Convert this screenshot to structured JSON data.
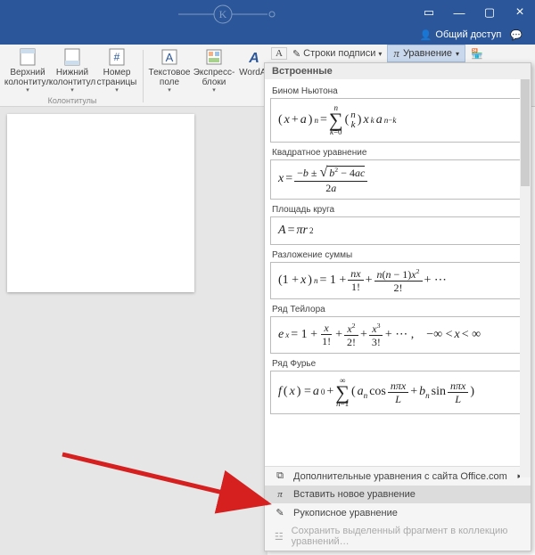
{
  "titlebar": {
    "min": "—",
    "max": "▢",
    "close": "×"
  },
  "secondbar": {
    "share": "Общий доступ"
  },
  "ribbon": {
    "group1_label": "Колонтитулы",
    "item_top": "Верхний колонтитул",
    "item_bottom": "Нижний колонтитул",
    "item_page": "Номер страницы",
    "item_text": "Текстовое поле",
    "item_express": "Экспресс-блоки",
    "item_wordart": "WordAr"
  },
  "toprow": {
    "sign_line": "Строки подписи",
    "equation_btn": "Уравнение"
  },
  "dropdown": {
    "builtin": "Встроенные",
    "eq": [
      {
        "label": "Бином Ньютона"
      },
      {
        "label": "Квадратное уравнение"
      },
      {
        "label": "Площадь круга"
      },
      {
        "label": "Разложение суммы"
      },
      {
        "label": "Ряд Тейлора"
      },
      {
        "label": "Ряд Фурье"
      }
    ],
    "footer": {
      "more": "Дополнительные уравнения с сайта Office.com",
      "insert": "Вставить новое уравнение",
      "ink": "Рукописное уравнение",
      "save": "Сохранить выделенный фрагмент в коллекцию уравнений…"
    }
  }
}
